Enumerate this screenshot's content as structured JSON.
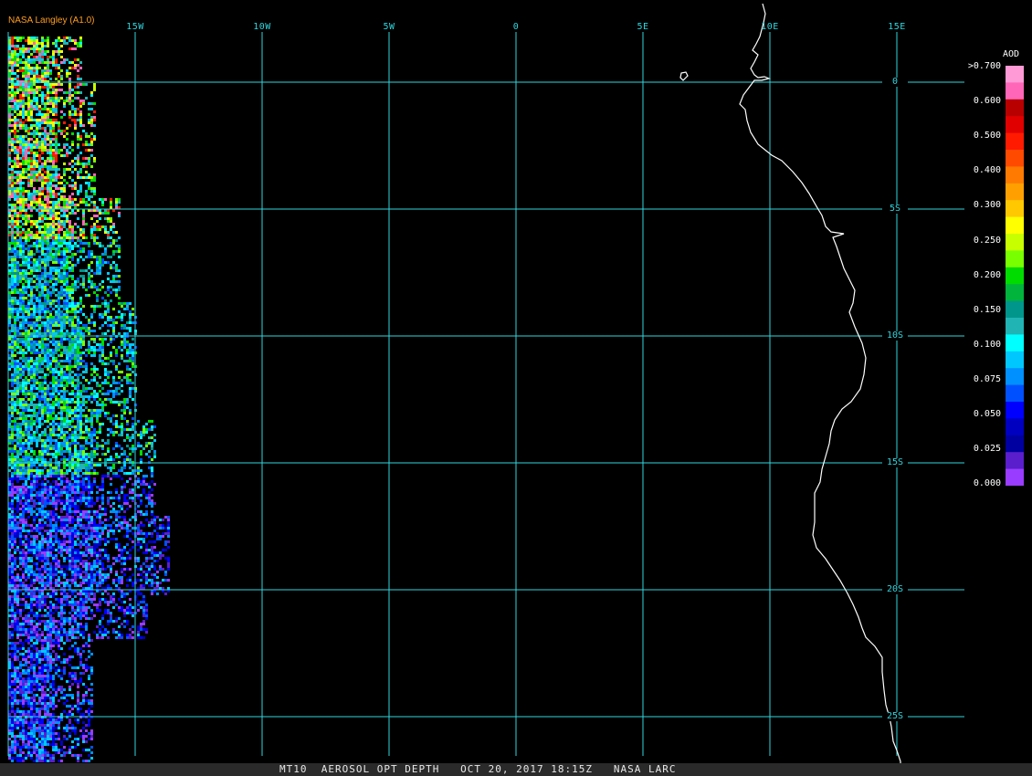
{
  "header": {
    "source": "NASA Langley (A1.0)"
  },
  "map": {
    "projection": "equirectangular",
    "longitude_labels": [
      "15W",
      "10W",
      "5W",
      "0",
      "5E",
      "10E",
      "15E"
    ],
    "latitude_labels": [
      "0",
      "5S",
      "10S",
      "15S",
      "20S",
      "25S"
    ],
    "gridline_color": "#2fd6de",
    "coastline_color": "#ffffff"
  },
  "legend": {
    "title": "AOD",
    "ticks": [
      ">0.700",
      "0.600",
      "0.500",
      "0.400",
      "0.300",
      "0.250",
      "0.200",
      "0.150",
      "0.100",
      "0.075",
      "0.050",
      "0.025",
      "0.000"
    ],
    "colors": [
      "#ff9ad6",
      "#ff66b8",
      "#b80000",
      "#e00000",
      "#ff1a00",
      "#ff4a00",
      "#ff7a00",
      "#ffa000",
      "#ffc800",
      "#ffff00",
      "#c8ff00",
      "#78ff00",
      "#00dc00",
      "#00b43c",
      "#00968c",
      "#20b4b4",
      "#00ffff",
      "#00c8ff",
      "#0090ff",
      "#0050ff",
      "#0000ff",
      "#0000c0",
      "#0000a0",
      "#5a1ecc",
      "#9a3cff"
    ]
  },
  "footer": {
    "caption": "MT10  AEROSOL OPT DEPTH   OCT 20, 2017 18:15Z   NASA LARC"
  }
}
